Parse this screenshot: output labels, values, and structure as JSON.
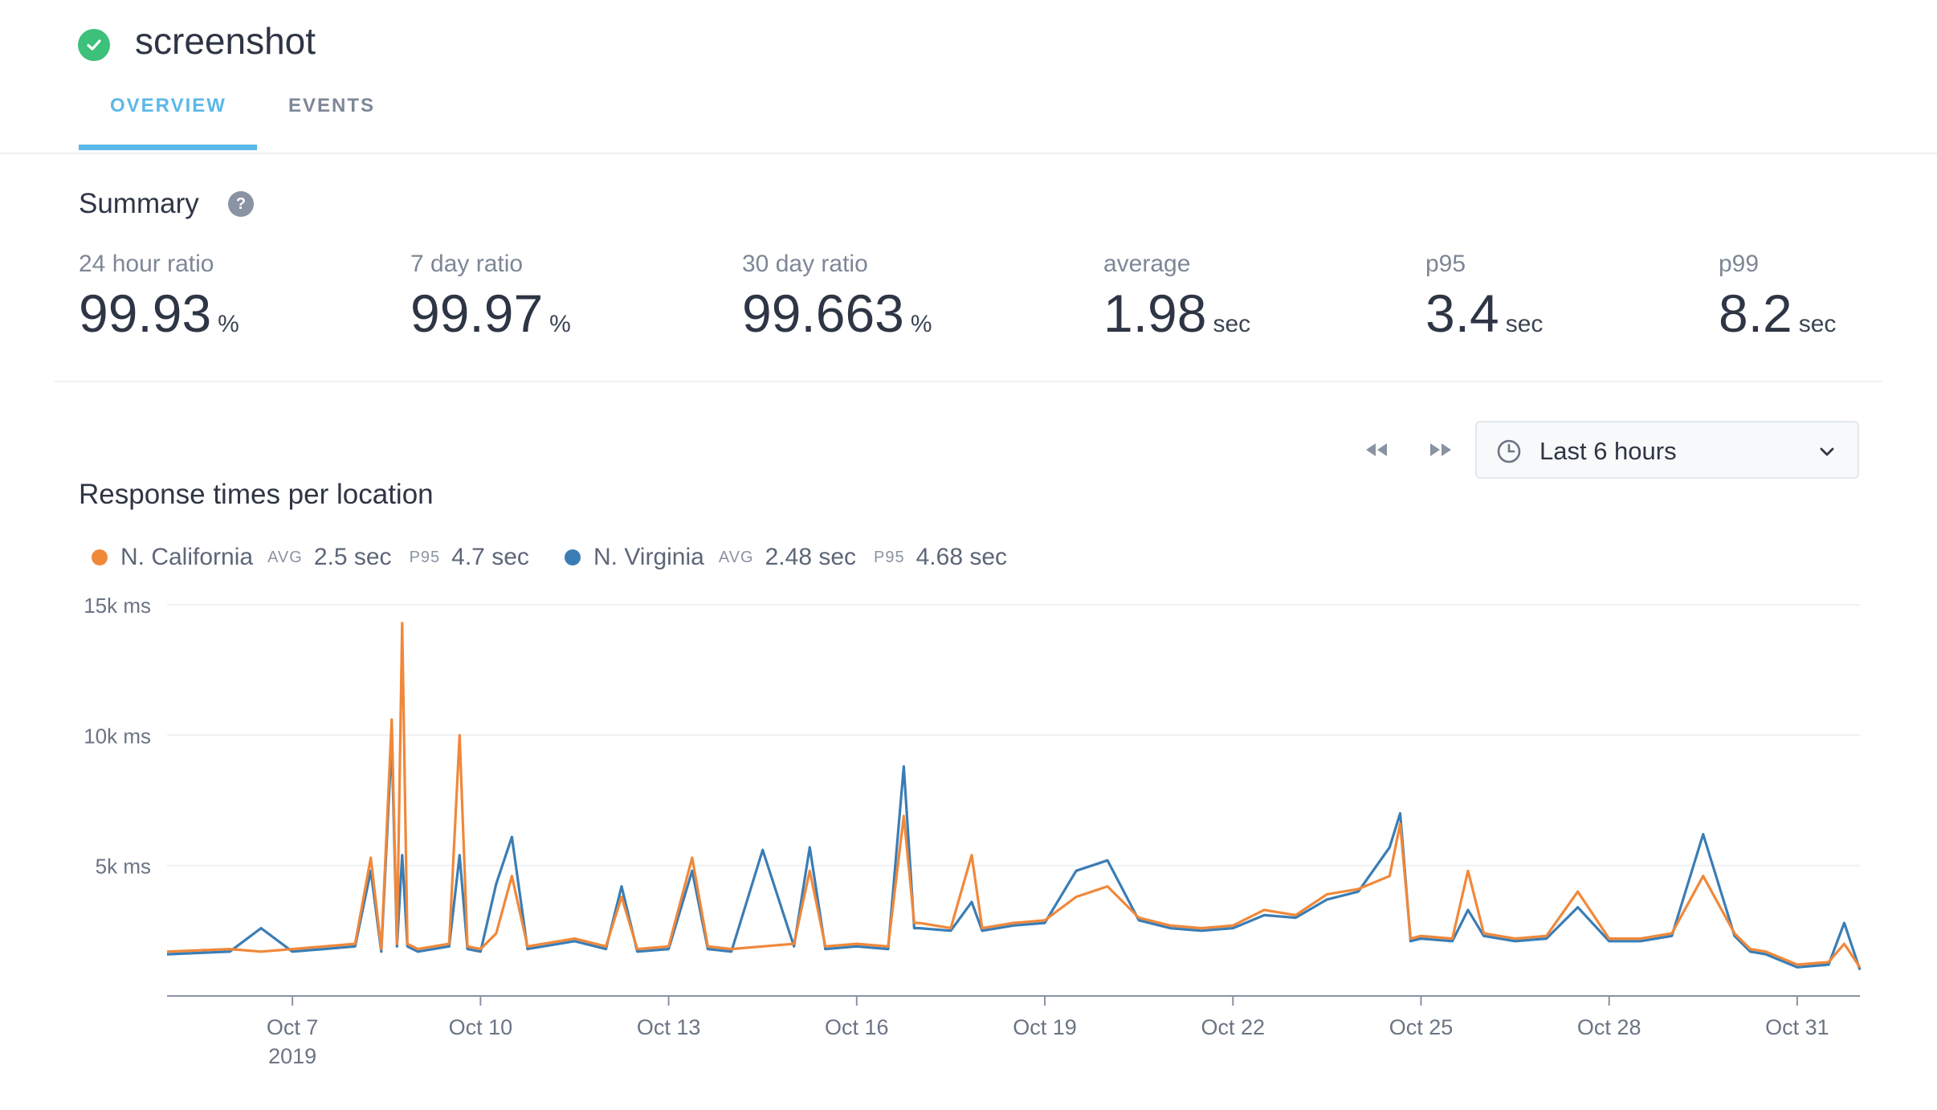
{
  "app": {
    "title": "screenshot",
    "status": "ok"
  },
  "tabs": [
    {
      "label": "OVERVIEW",
      "active": true
    },
    {
      "label": "EVENTS",
      "active": false
    }
  ],
  "summary": {
    "title": "Summary",
    "help": "?",
    "metrics": [
      {
        "label": "24 hour ratio",
        "value": "99.93",
        "unit": "%"
      },
      {
        "label": "7 day ratio",
        "value": "99.97",
        "unit": "%"
      },
      {
        "label": "30 day ratio",
        "value": "99.663",
        "unit": "%"
      },
      {
        "label": "average",
        "value": "1.98",
        "unit": "sec"
      },
      {
        "label": "p95",
        "value": "3.4",
        "unit": "sec"
      },
      {
        "label": "p99",
        "value": "8.2",
        "unit": "sec"
      }
    ]
  },
  "time_range": {
    "selected": "Last 6 hours",
    "icons": [
      "rewind-icon",
      "fast-forward-icon",
      "clock-icon",
      "chevron-down-icon"
    ]
  },
  "chart": {
    "title": "Response times per location",
    "legend": [
      {
        "name": "N. California",
        "avg_label": "AVG",
        "avg": "2.5 sec",
        "p95_label": "P95",
        "p95": "4.7 sec",
        "color": "#f0883a"
      },
      {
        "name": "N. Virginia",
        "avg_label": "AVG",
        "avg": "2.48 sec",
        "p95_label": "P95",
        "p95": "4.68 sec",
        "color": "#3a7db5"
      }
    ]
  },
  "colors": {
    "accent": "#5bb8e8",
    "success": "#3cc07a",
    "california": "#f0883a",
    "virginia": "#3a7db5"
  },
  "chart_data": {
    "type": "line",
    "title": "",
    "xlabel": "",
    "ylabel": "",
    "x_range": [
      "2019-10-05",
      "2019-11-01"
    ],
    "ylim": [
      0,
      15000
    ],
    "y_ticks": [
      5000,
      10000,
      15000
    ],
    "y_tick_labels": [
      "5k ms",
      "10k ms",
      "15k ms"
    ],
    "x_ticks": [
      "2019-10-07",
      "2019-10-10",
      "2019-10-13",
      "2019-10-16",
      "2019-10-19",
      "2019-10-22",
      "2019-10-25",
      "2019-10-28",
      "2019-10-31"
    ],
    "x_tick_labels": [
      "Oct 7",
      "Oct 10",
      "Oct 13",
      "Oct 16",
      "Oct 19",
      "Oct 22",
      "Oct 25",
      "Oct 28",
      "Oct 31"
    ],
    "x_tick_sublabel": "2019",
    "grid": true,
    "legend_position": "top-left",
    "series": [
      {
        "name": "N. California",
        "color": "#f0883a",
        "points": [
          [
            "2019-10-05",
            1700
          ],
          [
            "2019-10-06",
            1800
          ],
          [
            "2019-10-06 12:00",
            1700
          ],
          [
            "2019-10-07",
            1800
          ],
          [
            "2019-10-07 12:00",
            1900
          ],
          [
            "2019-10-08",
            2000
          ],
          [
            "2019-10-08 06:00",
            5300
          ],
          [
            "2019-10-08 10:00",
            1800
          ],
          [
            "2019-10-08 14:00",
            10600
          ],
          [
            "2019-10-08 16:00",
            2000
          ],
          [
            "2019-10-08 18:00",
            14300
          ],
          [
            "2019-10-08 20:00",
            2000
          ],
          [
            "2019-10-09",
            1800
          ],
          [
            "2019-10-09 12:00",
            2000
          ],
          [
            "2019-10-09 16:00",
            10000
          ],
          [
            "2019-10-09 19:00",
            1900
          ],
          [
            "2019-10-10",
            1800
          ],
          [
            "2019-10-10 06:00",
            2400
          ],
          [
            "2019-10-10 12:00",
            4600
          ],
          [
            "2019-10-10 18:00",
            1900
          ],
          [
            "2019-10-11",
            2000
          ],
          [
            "2019-10-11 12:00",
            2200
          ],
          [
            "2019-10-12",
            1900
          ],
          [
            "2019-10-12 06:00",
            3800
          ],
          [
            "2019-10-12 12:00",
            1800
          ],
          [
            "2019-10-13",
            1900
          ],
          [
            "2019-10-13 09:00",
            5300
          ],
          [
            "2019-10-13 15:00",
            1900
          ],
          [
            "2019-10-14",
            1800
          ],
          [
            "2019-10-14 12:00",
            1900
          ],
          [
            "2019-10-15",
            2000
          ],
          [
            "2019-10-15 06:00",
            4800
          ],
          [
            "2019-10-15 12:00",
            1900
          ],
          [
            "2019-10-16",
            2000
          ],
          [
            "2019-10-16 12:00",
            1900
          ],
          [
            "2019-10-16 18:00",
            6900
          ],
          [
            "2019-10-16 22:00",
            2800
          ],
          [
            "2019-10-17",
            2800
          ],
          [
            "2019-10-17 12:00",
            2600
          ],
          [
            "2019-10-17 20:00",
            5400
          ],
          [
            "2019-10-18",
            2600
          ],
          [
            "2019-10-18 12:00",
            2800
          ],
          [
            "2019-10-19",
            2900
          ],
          [
            "2019-10-19 12:00",
            3800
          ],
          [
            "2019-10-20",
            4200
          ],
          [
            "2019-10-20 12:00",
            3000
          ],
          [
            "2019-10-21",
            2700
          ],
          [
            "2019-10-21 12:00",
            2600
          ],
          [
            "2019-10-22",
            2700
          ],
          [
            "2019-10-22 12:00",
            3300
          ],
          [
            "2019-10-23",
            3100
          ],
          [
            "2019-10-23 12:00",
            3900
          ],
          [
            "2019-10-24",
            4100
          ],
          [
            "2019-10-24 12:00",
            4600
          ],
          [
            "2019-10-24 16:00",
            6600
          ],
          [
            "2019-10-24 20:00",
            2200
          ],
          [
            "2019-10-25",
            2300
          ],
          [
            "2019-10-25 12:00",
            2200
          ],
          [
            "2019-10-25 18:00",
            4800
          ],
          [
            "2019-10-26",
            2400
          ],
          [
            "2019-10-26 12:00",
            2200
          ],
          [
            "2019-10-27",
            2300
          ],
          [
            "2019-10-27 12:00",
            4000
          ],
          [
            "2019-10-28",
            2200
          ],
          [
            "2019-10-28 12:00",
            2200
          ],
          [
            "2019-10-29",
            2400
          ],
          [
            "2019-10-29 12:00",
            4600
          ],
          [
            "2019-10-30",
            2400
          ],
          [
            "2019-10-30 06:00",
            1800
          ],
          [
            "2019-10-30 12:00",
            1700
          ],
          [
            "2019-10-31",
            1200
          ],
          [
            "2019-10-31 12:00",
            1300
          ],
          [
            "2019-10-31 18:00",
            2000
          ],
          [
            "2019-11-01",
            1100
          ]
        ]
      },
      {
        "name": "N. Virginia",
        "color": "#3a7db5",
        "points": [
          [
            "2019-10-05",
            1600
          ],
          [
            "2019-10-06",
            1700
          ],
          [
            "2019-10-06 12:00",
            2600
          ],
          [
            "2019-10-07",
            1700
          ],
          [
            "2019-10-07 12:00",
            1800
          ],
          [
            "2019-10-08",
            1900
          ],
          [
            "2019-10-08 06:00",
            4800
          ],
          [
            "2019-10-08 10:00",
            1700
          ],
          [
            "2019-10-08 14:00",
            9800
          ],
          [
            "2019-10-08 16:00",
            1900
          ],
          [
            "2019-10-08 18:00",
            5400
          ],
          [
            "2019-10-08 20:00",
            1900
          ],
          [
            "2019-10-09",
            1700
          ],
          [
            "2019-10-09 12:00",
            1900
          ],
          [
            "2019-10-09 16:00",
            5400
          ],
          [
            "2019-10-09 19:00",
            1800
          ],
          [
            "2019-10-10",
            1700
          ],
          [
            "2019-10-10 06:00",
            4300
          ],
          [
            "2019-10-10 12:00",
            6100
          ],
          [
            "2019-10-10 18:00",
            1800
          ],
          [
            "2019-10-11",
            1900
          ],
          [
            "2019-10-11 12:00",
            2100
          ],
          [
            "2019-10-12",
            1800
          ],
          [
            "2019-10-12 06:00",
            4200
          ],
          [
            "2019-10-12 12:00",
            1700
          ],
          [
            "2019-10-13",
            1800
          ],
          [
            "2019-10-13 09:00",
            4800
          ],
          [
            "2019-10-13 15:00",
            1800
          ],
          [
            "2019-10-14",
            1700
          ],
          [
            "2019-10-14 12:00",
            5600
          ],
          [
            "2019-10-15",
            1900
          ],
          [
            "2019-10-15 06:00",
            5700
          ],
          [
            "2019-10-15 12:00",
            1800
          ],
          [
            "2019-10-16",
            1900
          ],
          [
            "2019-10-16 12:00",
            1800
          ],
          [
            "2019-10-16 18:00",
            8800
          ],
          [
            "2019-10-16 22:00",
            2600
          ],
          [
            "2019-10-17",
            2600
          ],
          [
            "2019-10-17 12:00",
            2500
          ],
          [
            "2019-10-17 20:00",
            3600
          ],
          [
            "2019-10-18",
            2500
          ],
          [
            "2019-10-18 12:00",
            2700
          ],
          [
            "2019-10-19",
            2800
          ],
          [
            "2019-10-19 12:00",
            4800
          ],
          [
            "2019-10-20",
            5200
          ],
          [
            "2019-10-20 12:00",
            2900
          ],
          [
            "2019-10-21",
            2600
          ],
          [
            "2019-10-21 12:00",
            2500
          ],
          [
            "2019-10-22",
            2600
          ],
          [
            "2019-10-22 12:00",
            3100
          ],
          [
            "2019-10-23",
            3000
          ],
          [
            "2019-10-23 12:00",
            3700
          ],
          [
            "2019-10-24",
            4000
          ],
          [
            "2019-10-24 12:00",
            5700
          ],
          [
            "2019-10-24 16:00",
            7000
          ],
          [
            "2019-10-24 20:00",
            2100
          ],
          [
            "2019-10-25",
            2200
          ],
          [
            "2019-10-25 12:00",
            2100
          ],
          [
            "2019-10-25 18:00",
            3300
          ],
          [
            "2019-10-26",
            2300
          ],
          [
            "2019-10-26 12:00",
            2100
          ],
          [
            "2019-10-27",
            2200
          ],
          [
            "2019-10-27 12:00",
            3400
          ],
          [
            "2019-10-28",
            2100
          ],
          [
            "2019-10-28 12:00",
            2100
          ],
          [
            "2019-10-29",
            2300
          ],
          [
            "2019-10-29 12:00",
            6200
          ],
          [
            "2019-10-30",
            2300
          ],
          [
            "2019-10-30 06:00",
            1700
          ],
          [
            "2019-10-30 12:00",
            1600
          ],
          [
            "2019-10-31",
            1100
          ],
          [
            "2019-10-31 12:00",
            1200
          ],
          [
            "2019-10-31 18:00",
            2800
          ],
          [
            "2019-11-01",
            1000
          ]
        ]
      }
    ]
  }
}
